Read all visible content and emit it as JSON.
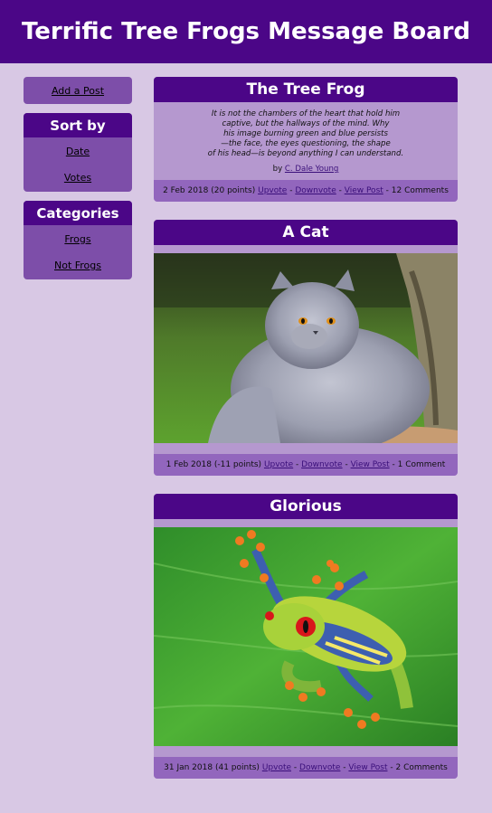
{
  "header": {
    "title": "Terrific Tree Frogs Message Board"
  },
  "sidebar": {
    "add_post": "Add a Post",
    "sort": {
      "title": "Sort by",
      "items": [
        "Date",
        "Votes"
      ]
    },
    "categories": {
      "title": "Categories",
      "items": [
        "Frogs",
        "Not Frogs"
      ]
    }
  },
  "posts": [
    {
      "title": "The Tree Frog",
      "poem": [
        "It is not the chambers of the heart that hold him",
        "captive, but the hallways of the mind. Why",
        "his image burning green and blue persists",
        "—the face, the eyes questioning, the shape",
        "of his head—is beyond anything I can understand."
      ],
      "by_prefix": "by",
      "author": "C. Dale Young",
      "date": "2 Feb 2018",
      "points": "(20 points)",
      "upvote": "Upvote",
      "downvote": "Downvote",
      "view": "View Post",
      "comments": "12 Comments",
      "sep": "-"
    },
    {
      "title": "A Cat",
      "date": "1 Feb 2018",
      "points": "(-11 points)",
      "upvote": "Upvote",
      "downvote": "Downvote",
      "view": "View Post",
      "comments": "1 Comment",
      "sep": "-"
    },
    {
      "title": "Glorious",
      "date": "31 Jan 2018",
      "points": "(41 points)",
      "upvote": "Upvote",
      "downvote": "Downvote",
      "view": "View Post",
      "comments": "2 Comments",
      "sep": "-"
    }
  ]
}
